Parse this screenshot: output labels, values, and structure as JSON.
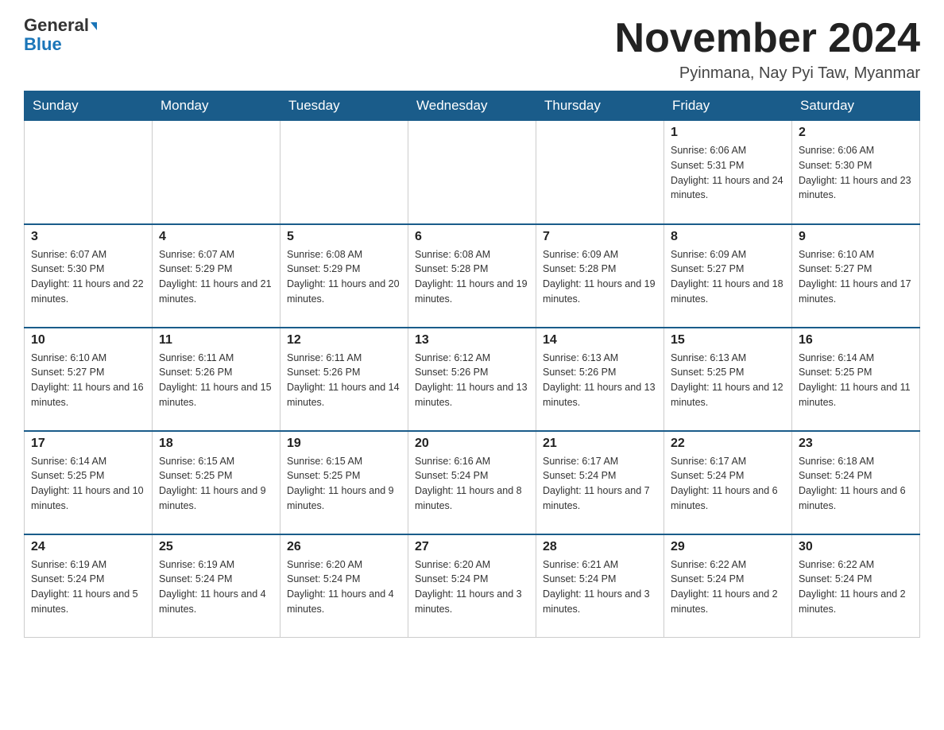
{
  "header": {
    "logo_line1": "General",
    "logo_line2": "Blue",
    "month_title": "November 2024",
    "location": "Pyinmana, Nay Pyi Taw, Myanmar"
  },
  "days_of_week": [
    "Sunday",
    "Monday",
    "Tuesday",
    "Wednesday",
    "Thursday",
    "Friday",
    "Saturday"
  ],
  "weeks": [
    [
      {
        "num": "",
        "info": ""
      },
      {
        "num": "",
        "info": ""
      },
      {
        "num": "",
        "info": ""
      },
      {
        "num": "",
        "info": ""
      },
      {
        "num": "",
        "info": ""
      },
      {
        "num": "1",
        "info": "Sunrise: 6:06 AM\nSunset: 5:31 PM\nDaylight: 11 hours and 24 minutes."
      },
      {
        "num": "2",
        "info": "Sunrise: 6:06 AM\nSunset: 5:30 PM\nDaylight: 11 hours and 23 minutes."
      }
    ],
    [
      {
        "num": "3",
        "info": "Sunrise: 6:07 AM\nSunset: 5:30 PM\nDaylight: 11 hours and 22 minutes."
      },
      {
        "num": "4",
        "info": "Sunrise: 6:07 AM\nSunset: 5:29 PM\nDaylight: 11 hours and 21 minutes."
      },
      {
        "num": "5",
        "info": "Sunrise: 6:08 AM\nSunset: 5:29 PM\nDaylight: 11 hours and 20 minutes."
      },
      {
        "num": "6",
        "info": "Sunrise: 6:08 AM\nSunset: 5:28 PM\nDaylight: 11 hours and 19 minutes."
      },
      {
        "num": "7",
        "info": "Sunrise: 6:09 AM\nSunset: 5:28 PM\nDaylight: 11 hours and 19 minutes."
      },
      {
        "num": "8",
        "info": "Sunrise: 6:09 AM\nSunset: 5:27 PM\nDaylight: 11 hours and 18 minutes."
      },
      {
        "num": "9",
        "info": "Sunrise: 6:10 AM\nSunset: 5:27 PM\nDaylight: 11 hours and 17 minutes."
      }
    ],
    [
      {
        "num": "10",
        "info": "Sunrise: 6:10 AM\nSunset: 5:27 PM\nDaylight: 11 hours and 16 minutes."
      },
      {
        "num": "11",
        "info": "Sunrise: 6:11 AM\nSunset: 5:26 PM\nDaylight: 11 hours and 15 minutes."
      },
      {
        "num": "12",
        "info": "Sunrise: 6:11 AM\nSunset: 5:26 PM\nDaylight: 11 hours and 14 minutes."
      },
      {
        "num": "13",
        "info": "Sunrise: 6:12 AM\nSunset: 5:26 PM\nDaylight: 11 hours and 13 minutes."
      },
      {
        "num": "14",
        "info": "Sunrise: 6:13 AM\nSunset: 5:26 PM\nDaylight: 11 hours and 13 minutes."
      },
      {
        "num": "15",
        "info": "Sunrise: 6:13 AM\nSunset: 5:25 PM\nDaylight: 11 hours and 12 minutes."
      },
      {
        "num": "16",
        "info": "Sunrise: 6:14 AM\nSunset: 5:25 PM\nDaylight: 11 hours and 11 minutes."
      }
    ],
    [
      {
        "num": "17",
        "info": "Sunrise: 6:14 AM\nSunset: 5:25 PM\nDaylight: 11 hours and 10 minutes."
      },
      {
        "num": "18",
        "info": "Sunrise: 6:15 AM\nSunset: 5:25 PM\nDaylight: 11 hours and 9 minutes."
      },
      {
        "num": "19",
        "info": "Sunrise: 6:15 AM\nSunset: 5:25 PM\nDaylight: 11 hours and 9 minutes."
      },
      {
        "num": "20",
        "info": "Sunrise: 6:16 AM\nSunset: 5:24 PM\nDaylight: 11 hours and 8 minutes."
      },
      {
        "num": "21",
        "info": "Sunrise: 6:17 AM\nSunset: 5:24 PM\nDaylight: 11 hours and 7 minutes."
      },
      {
        "num": "22",
        "info": "Sunrise: 6:17 AM\nSunset: 5:24 PM\nDaylight: 11 hours and 6 minutes."
      },
      {
        "num": "23",
        "info": "Sunrise: 6:18 AM\nSunset: 5:24 PM\nDaylight: 11 hours and 6 minutes."
      }
    ],
    [
      {
        "num": "24",
        "info": "Sunrise: 6:19 AM\nSunset: 5:24 PM\nDaylight: 11 hours and 5 minutes."
      },
      {
        "num": "25",
        "info": "Sunrise: 6:19 AM\nSunset: 5:24 PM\nDaylight: 11 hours and 4 minutes."
      },
      {
        "num": "26",
        "info": "Sunrise: 6:20 AM\nSunset: 5:24 PM\nDaylight: 11 hours and 4 minutes."
      },
      {
        "num": "27",
        "info": "Sunrise: 6:20 AM\nSunset: 5:24 PM\nDaylight: 11 hours and 3 minutes."
      },
      {
        "num": "28",
        "info": "Sunrise: 6:21 AM\nSunset: 5:24 PM\nDaylight: 11 hours and 3 minutes."
      },
      {
        "num": "29",
        "info": "Sunrise: 6:22 AM\nSunset: 5:24 PM\nDaylight: 11 hours and 2 minutes."
      },
      {
        "num": "30",
        "info": "Sunrise: 6:22 AM\nSunset: 5:24 PM\nDaylight: 11 hours and 2 minutes."
      }
    ]
  ]
}
